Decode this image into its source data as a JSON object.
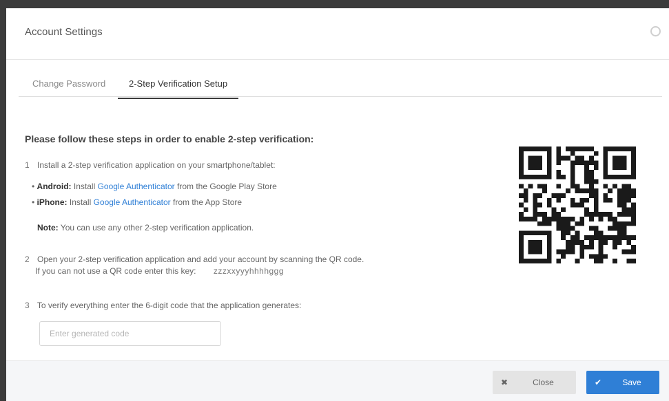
{
  "dialog": {
    "title": "Account Settings"
  },
  "tabs": [
    {
      "label": "Change Password",
      "active": false
    },
    {
      "label": "2-Step Verification Setup",
      "active": true
    }
  ],
  "content": {
    "heading": "Please follow these steps in order to enable 2-step verification:",
    "step1": {
      "num": "1",
      "text": "Install a 2-step verification application on your smartphone/tablet:"
    },
    "bullets": [
      {
        "platform": "Android:",
        "pre": "Install",
        "link": "Google Authenticator",
        "post": "from the Google Play Store"
      },
      {
        "platform": "iPhone:",
        "pre": "Install",
        "link": "Google Authenticator",
        "post": "from the App Store"
      }
    ],
    "note": {
      "label": "Note:",
      "text": "You can use any other 2-step verification application."
    },
    "step2": {
      "num": "2",
      "line1": "Open your 2-step verification application and add your account by scanning the QR code.",
      "line2": "If you can not use a QR code enter this key:",
      "key": "zzzxxyyyhhhhggg"
    },
    "step3": {
      "num": "3",
      "text": "To verify everything enter the 6-digit code that the application generates:"
    },
    "code_input": {
      "placeholder": "Enter generated code",
      "value": ""
    }
  },
  "footer": {
    "close_label": "Close",
    "save_label": "Save"
  },
  "icons": {
    "dialog_close": "close-circle-icon",
    "close_button": "x-icon",
    "save_button": "check-icon"
  },
  "colors": {
    "accent": "#2f7fd6",
    "link": "#2f7fd6"
  }
}
